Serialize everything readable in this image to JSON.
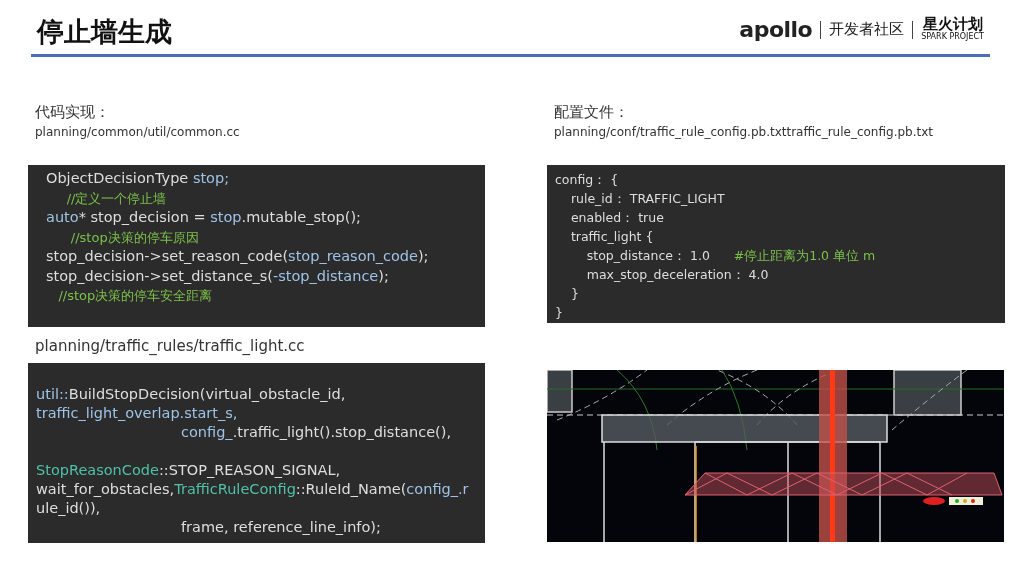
{
  "header": {
    "title": "停止墙生成",
    "logo": {
      "brand": "apollo",
      "community": "开发者社区",
      "program": "星火计划",
      "program_en": "SPARK PROJECT"
    }
  },
  "left": {
    "label": "代码实现：",
    "path": "planning/common/util/common.cc",
    "code_1": [
      {
        "kind": "code",
        "segments": [
          {
            "kind": "plain",
            "text": "ObjectDecisionType "
          },
          {
            "kind": "var",
            "text": "stop;"
          }
        ]
      },
      {
        "kind": "code",
        "segments": [
          {
            "kind": "comment",
            "text": "     //定义一个停止墙"
          }
        ]
      },
      {
        "kind": "code",
        "segments": [
          {
            "kind": "var",
            "text": "auto"
          },
          {
            "kind": "plain",
            "text": "* stop_decision = "
          },
          {
            "kind": "var",
            "text": "stop"
          },
          {
            "kind": "plain",
            "text": ".mutable_stop();"
          }
        ]
      },
      {
        "kind": "code",
        "segments": [
          {
            "kind": "comment",
            "text": "      //stop决策的停车原因"
          }
        ]
      },
      {
        "kind": "code",
        "segments": [
          {
            "kind": "plain",
            "text": "stop_decision->set_reason_code("
          },
          {
            "kind": "var",
            "text": "stop_reason_code"
          },
          {
            "kind": "plain",
            "text": ");"
          }
        ]
      },
      {
        "kind": "code",
        "segments": [
          {
            "kind": "plain",
            "text": "stop_decision->set_distance_s("
          },
          {
            "kind": "var",
            "text": "-stop_distance"
          },
          {
            "kind": "plain",
            "text": ");"
          }
        ]
      },
      {
        "kind": "code",
        "segments": [
          {
            "kind": "comment",
            "text": "   //stop决策的停车安全距离"
          }
        ]
      }
    ],
    "path_2": "planning/traffic_rules/traffic_light.cc",
    "code_2": [
      {
        "kind": "code",
        "segments": [
          {
            "kind": "var",
            "text": "util::"
          },
          {
            "kind": "plain",
            "text": "BuildStopDecision(virtual_obstacle_id,"
          }
        ]
      },
      {
        "kind": "code",
        "segments": [
          {
            "kind": "var",
            "text": "traffic_light_overlap.start_s,"
          }
        ]
      },
      {
        "kind": "continuation",
        "segments": [
          {
            "kind": "var",
            "text": "config_"
          },
          {
            "kind": "plain",
            "text": ".traffic_light().stop_distance(),"
          }
        ]
      },
      {
        "kind": "blank"
      },
      {
        "kind": "code",
        "segments": [
          {
            "kind": "type",
            "text": "StopReasonCode"
          },
          {
            "kind": "plain",
            "text": "::STOP_REASON_SIGNAL,"
          }
        ]
      },
      {
        "kind": "code",
        "segments": [
          {
            "kind": "plain",
            "text": "wait_for_obstacles,"
          },
          {
            "kind": "type",
            "text": "TrafficRuleConfig"
          },
          {
            "kind": "plain",
            "text": "::RuleId_Name("
          },
          {
            "kind": "var",
            "text": "config_.r"
          }
        ]
      },
      {
        "kind": "code",
        "segments": [
          {
            "kind": "plain",
            "text": "ule_id()),"
          }
        ]
      },
      {
        "kind": "continuation",
        "segments": [
          {
            "kind": "plain",
            "text": "frame, reference_line_info);"
          }
        ]
      }
    ]
  },
  "right": {
    "label": "配置文件：",
    "path": "planning/conf/traffic_rule_config.pb.txttraffic_rule_config.pb.txt",
    "config": [
      {
        "kind": "code",
        "segments": [
          {
            "kind": "plain",
            "text": "config： {"
          }
        ]
      },
      {
        "kind": "code",
        "segments": [
          {
            "kind": "plain",
            "text": "    rule_id： TRAFFIC_LIGHT"
          }
        ]
      },
      {
        "kind": "code",
        "segments": [
          {
            "kind": "plain",
            "text": "    enabled： true"
          }
        ]
      },
      {
        "kind": "code",
        "segments": [
          {
            "kind": "plain",
            "text": "    traffic_light {"
          }
        ]
      },
      {
        "kind": "code",
        "segments": [
          {
            "kind": "plain",
            "text": "        stop_distance： 1.0      "
          },
          {
            "kind": "comment",
            "text": "#停止距离为1.0 单位 m"
          }
        ]
      },
      {
        "kind": "code",
        "segments": [
          {
            "kind": "plain",
            "text": "        max_stop_deceleration： 4.0"
          }
        ]
      },
      {
        "kind": "code",
        "segments": [
          {
            "kind": "plain",
            "text": "    }"
          }
        ]
      },
      {
        "kind": "code",
        "segments": [
          {
            "kind": "plain",
            "text": "}"
          }
        ]
      }
    ]
  }
}
